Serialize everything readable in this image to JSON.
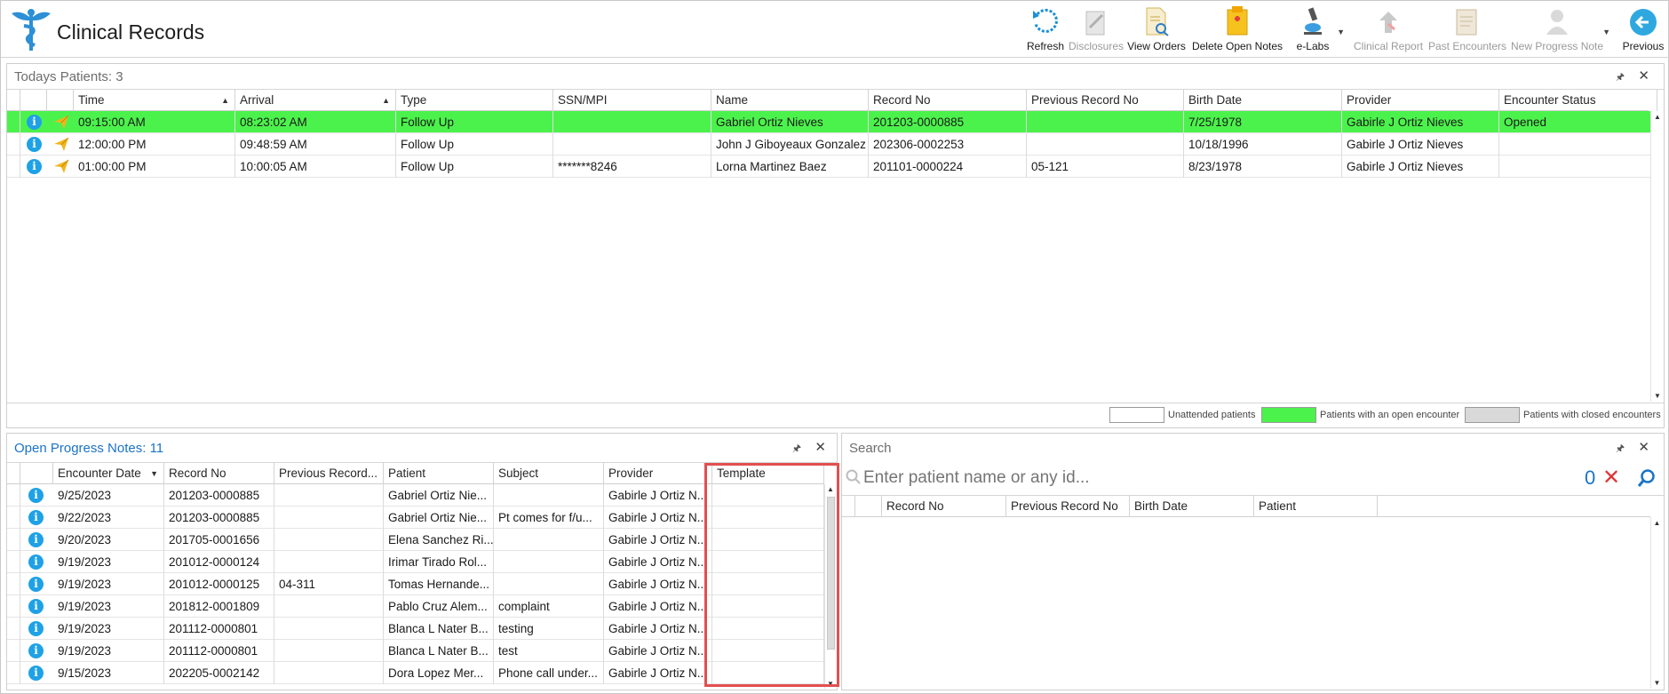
{
  "app": {
    "title": "Clinical Records"
  },
  "toolbar": {
    "refresh": "Refresh",
    "disclosures": "Disclosures",
    "view_orders": "View Orders",
    "delete_open_notes": "Delete Open Notes",
    "elabs": "e-Labs",
    "clinical_report": "Clinical Report",
    "past_encounters": "Past Encounters",
    "new_progress_note": "New Progress Note",
    "previous": "Previous"
  },
  "todays": {
    "title": "Todays Patients:",
    "count": "3",
    "columns": [
      "Time",
      "Arrival",
      "Type",
      "SSN/MPI",
      "Name",
      "Record No",
      "Previous Record No",
      "Birth Date",
      "Provider",
      "Encounter Status"
    ],
    "rows": [
      {
        "time": "09:15:00 AM",
        "arrival": "08:23:02 AM",
        "type": "Follow Up",
        "ssn": "",
        "name": "Gabriel Ortiz Nieves",
        "record": "201203-0000885",
        "prev": "",
        "birth": "7/25/1978",
        "provider": "Gabirle J Ortiz Nieves",
        "status": "Opened"
      },
      {
        "time": "12:00:00 PM",
        "arrival": "09:48:59 AM",
        "type": "Follow Up",
        "ssn": "",
        "name": "John J Giboyeaux Gonzalez",
        "record": "202306-0002253",
        "prev": "",
        "birth": "10/18/1996",
        "provider": "Gabirle J Ortiz Nieves",
        "status": ""
      },
      {
        "time": "01:00:00 PM",
        "arrival": "10:00:05 AM",
        "type": "Follow Up",
        "ssn": "*******8246",
        "name": "Lorna Martinez Baez",
        "record": "201101-0000224",
        "prev": "05-121",
        "birth": "8/23/1978",
        "provider": "Gabirle J Ortiz Nieves",
        "status": ""
      }
    ],
    "legend": {
      "unattended": "Unattended patients",
      "open": "Patients with an open encounter",
      "closed": "Patients with closed encounters"
    }
  },
  "notes": {
    "title": "Open Progress Notes:",
    "count": "11",
    "columns": [
      "Encounter Date",
      "Record No",
      "Previous Record...",
      "Patient",
      "Subject",
      "Provider",
      "Template"
    ],
    "rows": [
      {
        "date": "9/25/2023",
        "record": "201203-0000885",
        "prev": "",
        "patient": "Gabriel Ortiz Nie...",
        "subject": "",
        "provider": "Gabirle J Ortiz N...",
        "template": ""
      },
      {
        "date": "9/22/2023",
        "record": "201203-0000885",
        "prev": "",
        "patient": "Gabriel Ortiz Nie...",
        "subject": "Pt comes for f/u...",
        "provider": "Gabirle J Ortiz N...",
        "template": ""
      },
      {
        "date": "9/20/2023",
        "record": "201705-0001656",
        "prev": "",
        "patient": "Elena Sanchez Ri...",
        "subject": "",
        "provider": "Gabirle J Ortiz N...",
        "template": ""
      },
      {
        "date": "9/19/2023",
        "record": "201012-0000124",
        "prev": "",
        "patient": "Irimar Tirado Rol...",
        "subject": "",
        "provider": "Gabirle J Ortiz N...",
        "template": ""
      },
      {
        "date": "9/19/2023",
        "record": "201012-0000125",
        "prev": "04-311",
        "patient": "Tomas Hernande...",
        "subject": "",
        "provider": "Gabirle J Ortiz N...",
        "template": ""
      },
      {
        "date": "9/19/2023",
        "record": "201812-0001809",
        "prev": "",
        "patient": "Pablo Cruz Alem...",
        "subject": "complaint",
        "provider": "Gabirle J Ortiz N...",
        "template": ""
      },
      {
        "date": "9/19/2023",
        "record": "201112-0000801",
        "prev": "",
        "patient": "Blanca L Nater B...",
        "subject": "testing",
        "provider": "Gabirle J Ortiz N...",
        "template": ""
      },
      {
        "date": "9/19/2023",
        "record": "201112-0000801",
        "prev": "",
        "patient": "Blanca L Nater B...",
        "subject": "test",
        "provider": "Gabirle J Ortiz N...",
        "template": ""
      },
      {
        "date": "9/15/2023",
        "record": "202205-0002142",
        "prev": "",
        "patient": "Dora Lopez Mer...",
        "subject": "Phone call under...",
        "provider": "Gabirle J Ortiz N...",
        "template": ""
      }
    ]
  },
  "search": {
    "title": "Search",
    "placeholder": "Enter patient name or any id...",
    "count": "0",
    "columns": [
      "Record No",
      "Previous Record No",
      "Birth Date",
      "Patient"
    ]
  },
  "colors": {
    "open_encounter": "#4cf24c",
    "accent": "#1b73c8",
    "highlight": "#e15050"
  }
}
